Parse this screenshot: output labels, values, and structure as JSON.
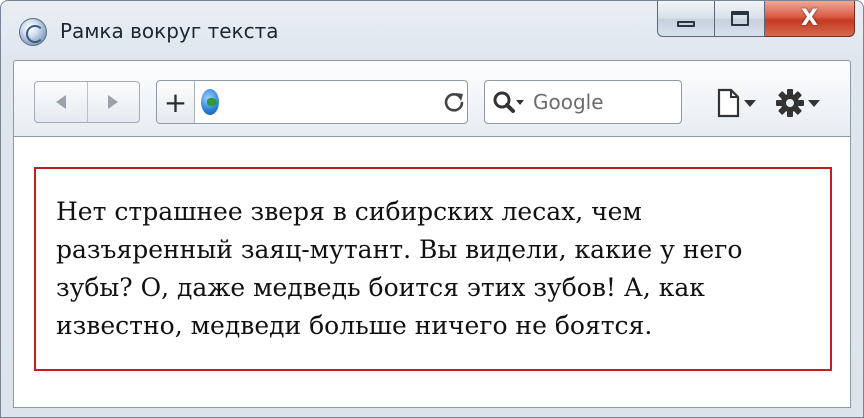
{
  "window": {
    "title": "Рамка вокруг текста",
    "close_label": "X"
  },
  "toolbar": {
    "back_icon": "back-arrow-icon",
    "forward_icon": "forward-arrow-icon",
    "new_tab_label": "+",
    "address_value": "",
    "reload_icon": "reload-icon",
    "search_placeholder": "Google",
    "page_menu_icon": "page-icon",
    "tools_menu_icon": "gear-icon"
  },
  "page": {
    "paragraph_lines": [
      "Нет страшнее зверя в сибирских лесах, чем",
      "разъяренный заяц-мутант. Вы видели, какие у него",
      "зубы? О, даже медведь боится этих зубов! А, как",
      "известно, медведи больше ничего не боятся."
    ],
    "border_color": "#c0201c"
  }
}
